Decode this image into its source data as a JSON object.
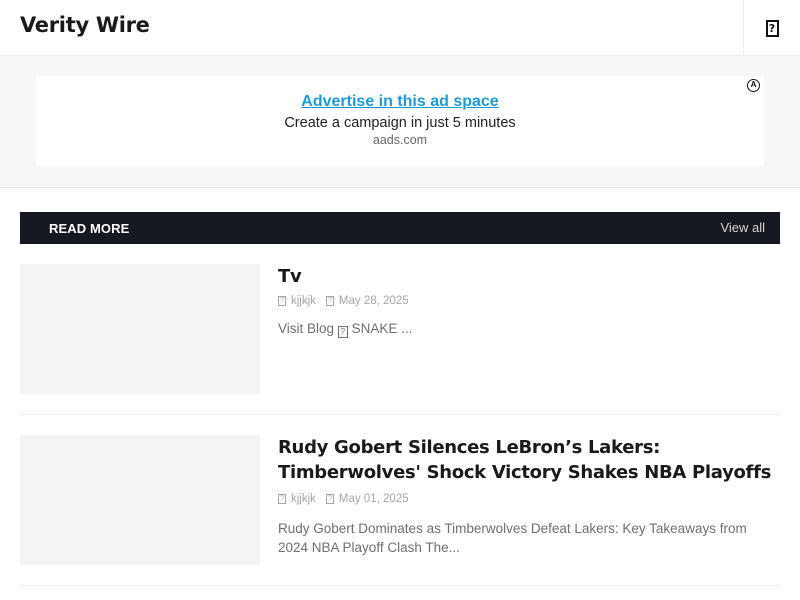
{
  "header": {
    "logo": "Verity Wire",
    "menu_icon": "missing-glyph-icon"
  },
  "ad": {
    "link_text": "Advertise in this ad space",
    "subtitle": "Create a campaign in just 5 minutes",
    "domain": "aads.com",
    "badge": "A",
    "link_color": "#1b9ad6"
  },
  "section": {
    "title": "READ MORE",
    "view_all": "View all",
    "bar_color": "#161821"
  },
  "posts": [
    {
      "title": "Tv",
      "author": "kjjkjk",
      "date": "May 28, 2025",
      "excerpt_prefix": "Visit Blog",
      "excerpt_suffix": "SNAKE ..."
    },
    {
      "title": "Rudy Gobert Silences LeBron’s Lakers: Timberwolves' Shock Victory Shakes NBA Playoffs",
      "author": "kjjkjk",
      "date": "May 01, 2025",
      "excerpt": "Rudy Gobert Dominates as Timberwolves Defeat Lakers: Key Takeaways from 2024 NBA Playoff Clash The..."
    }
  ]
}
